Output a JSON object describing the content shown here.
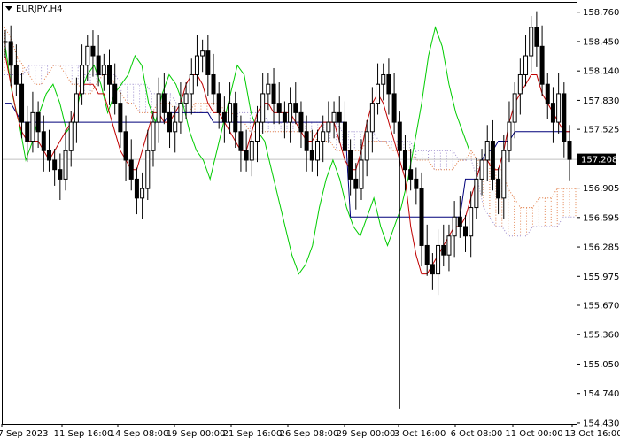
{
  "window": {
    "symbol_label": "EURJPY,H4",
    "menu_icon": "triangle-down-icon"
  },
  "chart_data": {
    "type": "candlestick",
    "title": "EURJPY,H4",
    "symbol": "EURJPY",
    "timeframe": "H4",
    "current_price": "157.208",
    "ylim": [
      154.42,
      158.86
    ],
    "y_ticks": [
      "158.760",
      "158.450",
      "158.140",
      "157.830",
      "157.525",
      "157.208",
      "156.905",
      "156.595",
      "156.285",
      "155.975",
      "155.670",
      "155.360",
      "155.050",
      "154.740",
      "154.430"
    ],
    "x_ticks": [
      "7 Sep 2023",
      "11 Sep 16:00",
      "14 Sep 08:00",
      "19 Sep 00:00",
      "21 Sep 16:00",
      "26 Sep 08:00",
      "29 Sep 00:00",
      "3 Oct 16:00",
      "6 Oct 08:00",
      "11 Oct 00:00",
      "13 Oct 16:00"
    ],
    "close_series": [
      158.45,
      158.2,
      158.0,
      157.6,
      157.4,
      157.7,
      157.5,
      157.3,
      157.2,
      157.1,
      157.0,
      157.3,
      157.6,
      157.9,
      158.2,
      158.4,
      158.3,
      158.1,
      158.2,
      158.0,
      157.8,
      157.5,
      157.2,
      157.0,
      156.8,
      156.9,
      157.3,
      157.6,
      157.9,
      157.7,
      157.5,
      157.6,
      157.8,
      157.9,
      158.1,
      158.3,
      158.35,
      158.1,
      157.9,
      157.7,
      157.6,
      157.8,
      157.5,
      157.3,
      157.2,
      157.4,
      157.6,
      157.9,
      158.0,
      157.8,
      157.7,
      157.6,
      157.8,
      157.7,
      157.5,
      157.3,
      157.2,
      157.4,
      157.5,
      157.6,
      157.7,
      157.6,
      157.3,
      157.0,
      156.9,
      157.2,
      157.5,
      157.8,
      158.0,
      158.1,
      157.9,
      157.6,
      157.3,
      157.1,
      157.0,
      156.9,
      156.3,
      156.1,
      156.0,
      156.3,
      156.2,
      156.4,
      156.6,
      156.5,
      156.4,
      156.7,
      157.0,
      157.2,
      157.4,
      157.0,
      156.8,
      157.3,
      157.6,
      157.9,
      158.1,
      158.3,
      158.6,
      158.4,
      158.0,
      157.8,
      157.6,
      157.9,
      157.4,
      157.208
    ],
    "series": [
      {
        "name": "Tenkan-sen",
        "color": "#c00000",
        "values": [
          158.3,
          158.0,
          157.7,
          157.5,
          157.4,
          157.4,
          157.4,
          157.3,
          157.2,
          157.3,
          157.4,
          157.5,
          157.6,
          157.8,
          158.0,
          158.0,
          158.0,
          157.9,
          157.9,
          157.7,
          157.5,
          157.3,
          157.2,
          157.1,
          157.1,
          157.3,
          157.5,
          157.7,
          157.7,
          157.6,
          157.6,
          157.7,
          157.8,
          158.0,
          158.1,
          158.1,
          158.0,
          157.8,
          157.7,
          157.7,
          157.6,
          157.5,
          157.4,
          157.3,
          157.3,
          157.5,
          157.7,
          157.8,
          157.8,
          157.7,
          157.7,
          157.7,
          157.7,
          157.6,
          157.5,
          157.4,
          157.4,
          157.5,
          157.6,
          157.6,
          157.6,
          157.4,
          157.2,
          157.1,
          157.1,
          157.3,
          157.6,
          157.8,
          157.9,
          157.8,
          157.6,
          157.4,
          157.2,
          157.0,
          156.5,
          156.2,
          156.0,
          156.0,
          156.1,
          156.2,
          156.3,
          156.4,
          156.5,
          156.5,
          156.6,
          156.8,
          157.0,
          157.2,
          157.2,
          157.1,
          157.1,
          157.3,
          157.6,
          157.8,
          157.9,
          158.0,
          158.1,
          158.1,
          157.9,
          157.8,
          157.7,
          157.6,
          157.5,
          157.5
        ]
      },
      {
        "name": "Kijun-sen",
        "color": "#00007a",
        "values": [
          157.8,
          157.8,
          157.7,
          157.6,
          157.6,
          157.6,
          157.6,
          157.6,
          157.6,
          157.6,
          157.6,
          157.6,
          157.6,
          157.6,
          157.6,
          157.6,
          157.6,
          157.6,
          157.6,
          157.6,
          157.6,
          157.6,
          157.6,
          157.6,
          157.6,
          157.6,
          157.6,
          157.6,
          157.6,
          157.6,
          157.7,
          157.7,
          157.7,
          157.7,
          157.7,
          157.7,
          157.7,
          157.7,
          157.6,
          157.6,
          157.6,
          157.6,
          157.6,
          157.6,
          157.6,
          157.6,
          157.6,
          157.6,
          157.6,
          157.6,
          157.6,
          157.6,
          157.6,
          157.6,
          157.6,
          157.6,
          157.6,
          157.6,
          157.6,
          157.6,
          157.6,
          157.6,
          157.6,
          156.6,
          156.6,
          156.6,
          156.6,
          156.6,
          156.6,
          156.6,
          156.6,
          156.6,
          156.6,
          156.6,
          156.6,
          156.6,
          156.6,
          156.6,
          156.6,
          156.6,
          156.6,
          156.6,
          156.6,
          156.6,
          157.0,
          157.0,
          157.0,
          157.2,
          157.3,
          157.3,
          157.4,
          157.4,
          157.4,
          157.5,
          157.5,
          157.5,
          157.5,
          157.5,
          157.5,
          157.5,
          157.5,
          157.5,
          157.5,
          157.5
        ]
      },
      {
        "name": "Chikou Span",
        "color": "#00cc00",
        "values": [
          158.4,
          157.9,
          157.6,
          157.2,
          157.4,
          157.7,
          157.9,
          158.0,
          157.8,
          157.5,
          157.6,
          157.9,
          158.1,
          158.2,
          158.0,
          157.7,
          157.9,
          158.0,
          158.1,
          158.3,
          158.2,
          157.8,
          157.6,
          157.9,
          158.1,
          158.0,
          157.8,
          157.5,
          157.3,
          157.2,
          157.0,
          157.3,
          157.6,
          157.9,
          158.2,
          158.1,
          157.7,
          157.5,
          157.4,
          157.1,
          156.8,
          156.5,
          156.2,
          156.0,
          156.1,
          156.3,
          156.7,
          157.0,
          157.2,
          157.0,
          156.7,
          156.5,
          156.4,
          156.6,
          156.8,
          156.5,
          156.3,
          156.5,
          156.7,
          157.0,
          157.4,
          157.8,
          158.3,
          158.6,
          158.4,
          158.0,
          157.7,
          157.5,
          157.3
        ]
      },
      {
        "name": "Senkou Span A",
        "color": "#e07840",
        "values": [
          158.6,
          158.5,
          158.3,
          158.2,
          158.1,
          158.0,
          158.0,
          158.1,
          158.2,
          158.2,
          158.1,
          158.0,
          158.0,
          157.9,
          157.9,
          158.0,
          158.1,
          158.1,
          158.0,
          157.9,
          157.8,
          157.8,
          157.7,
          157.7,
          157.7,
          157.8,
          157.8,
          157.8,
          157.7,
          157.7,
          157.7,
          157.8,
          157.8,
          157.8,
          157.8,
          157.8,
          157.7,
          157.7,
          157.6,
          157.6,
          157.5,
          157.5,
          157.5,
          157.5,
          157.5,
          157.5,
          157.5,
          157.5,
          157.5,
          157.5,
          157.5,
          157.4,
          157.4,
          157.4,
          157.3,
          157.3,
          157.3,
          157.3,
          157.3,
          157.4,
          157.4,
          157.4,
          157.4,
          157.3,
          157.3,
          157.3,
          157.3,
          157.2,
          157.2,
          157.2,
          157.1,
          157.1,
          157.1,
          157.1,
          157.2,
          157.2,
          157.3,
          157.2,
          157.2,
          157.2,
          157.1,
          157.1,
          156.9,
          156.8,
          156.7,
          156.7,
          156.7,
          156.8,
          156.8,
          156.8,
          156.9,
          156.9,
          156.9,
          156.9
        ]
      },
      {
        "name": "Senkou Span B",
        "color": "#9a8acc",
        "values": [
          158.1,
          158.1,
          158.1,
          158.1,
          158.2,
          158.2,
          158.2,
          158.2,
          158.2,
          158.2,
          158.2,
          158.2,
          158.2,
          158.1,
          158.1,
          158.1,
          158.1,
          158.1,
          158.1,
          158.0,
          158.0,
          158.0,
          158.0,
          158.0,
          157.9,
          157.9,
          157.9,
          157.9,
          157.8,
          157.8,
          157.7,
          157.7,
          157.7,
          157.7,
          157.7,
          157.7,
          157.7,
          157.7,
          157.7,
          157.7,
          157.7,
          157.7,
          157.7,
          157.6,
          157.6,
          157.6,
          157.6,
          157.6,
          157.6,
          157.6,
          157.6,
          157.6,
          157.6,
          157.6,
          157.6,
          157.5,
          157.5,
          157.5,
          157.5,
          157.5,
          157.5,
          157.4,
          157.4,
          157.4,
          157.4,
          157.4,
          157.4,
          157.3,
          157.3,
          157.3,
          157.3,
          157.3,
          157.3,
          157.3,
          157.2,
          157.2,
          157.2,
          157.0,
          156.7,
          156.6,
          156.5,
          156.5,
          156.4,
          156.4,
          156.4,
          156.4,
          156.5,
          156.5,
          156.5,
          156.5,
          156.5,
          156.6,
          156.6,
          156.6
        ]
      }
    ],
    "grid": false,
    "current_price_line_color": "#c0c0c0"
  }
}
